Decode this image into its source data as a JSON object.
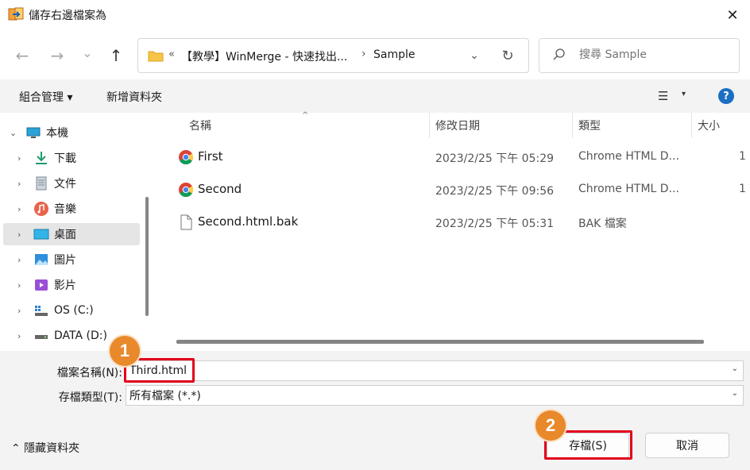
{
  "window": {
    "title": "儲存右邊檔案為",
    "close_glyph": "✕"
  },
  "nav": {
    "back_glyph": "←",
    "forward_glyph": "→",
    "recent_glyph": "⌄",
    "up_glyph": "↑",
    "address_prefix": "«",
    "address_crumb1": "【教學】WinMerge - 快速找出...",
    "address_separator": "›",
    "address_crumb2": "Sample",
    "address_dropdown_glyph": "⌄",
    "refresh_glyph": "↻",
    "search_placeholder": "搜尋 Sample",
    "search_glyph": "⚲"
  },
  "commandbar": {
    "organize_label": "組合管理 ▾",
    "new_folder_label": "新增資料夾",
    "view_glyph": "☰",
    "view_dropdown_glyph": "▾",
    "help_glyph": "?"
  },
  "sidebar": {
    "items": [
      {
        "label": "本機",
        "icon": "computer-icon",
        "chevron": "⌄"
      },
      {
        "label": "下載",
        "icon": "download-icon",
        "chevron": "›"
      },
      {
        "label": "文件",
        "icon": "document-icon",
        "chevron": "›"
      },
      {
        "label": "音樂",
        "icon": "music-icon",
        "chevron": "›"
      },
      {
        "label": "桌面",
        "icon": "desktop-icon",
        "chevron": "›",
        "selected": true
      },
      {
        "label": "圖片",
        "icon": "pictures-icon",
        "chevron": "›"
      },
      {
        "label": "影片",
        "icon": "videos-icon",
        "chevron": "›"
      },
      {
        "label": "OS (C:)",
        "icon": "drive-icon",
        "chevron": "›"
      },
      {
        "label": "DATA (D:)",
        "icon": "drive-icon",
        "chevron": "›"
      }
    ]
  },
  "filelist": {
    "columns": [
      "名稱",
      "修改日期",
      "類型",
      "大小"
    ],
    "sort_glyph": "^",
    "rows": [
      {
        "name": "First",
        "date": "2023/2/25 下午 05:29",
        "type": "Chrome HTML D...",
        "size": "1",
        "icon": "chrome-icon"
      },
      {
        "name": "Second",
        "date": "2023/2/25 下午 09:56",
        "type": "Chrome HTML D...",
        "size": "1",
        "icon": "chrome-icon"
      },
      {
        "name": "Second.html.bak",
        "date": "2023/2/25 下午 05:31",
        "type": "BAK 檔案",
        "size": "",
        "icon": "file-icon"
      }
    ]
  },
  "form": {
    "filename_label": "檔案名稱(N):",
    "filename_value": "Third.html",
    "filetype_label": "存檔類型(T):",
    "filetype_value": "所有檔案 (*.*)",
    "dropdown_glyph": "⌄"
  },
  "footer": {
    "hide_folders_label": "⌃ 隱藏資料夾",
    "save_label": "存檔(S)",
    "cancel_label": "取消"
  },
  "annotations": {
    "badge1": "1",
    "badge2": "2",
    "accent_red": "#e3001b",
    "badge_color": "#e8892c"
  }
}
